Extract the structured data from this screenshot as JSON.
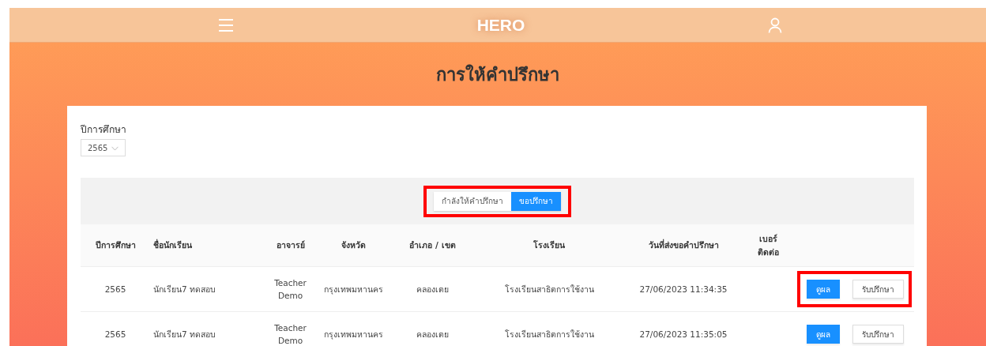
{
  "header": {
    "logo": "HERO"
  },
  "page_title": "การให้คำปรึกษา",
  "filter": {
    "label": "ปีการศึกษา",
    "value": "2565"
  },
  "toggle": {
    "highlighted": true,
    "options": [
      {
        "label": "กำลังให้คำปรึกษา",
        "selected": false
      },
      {
        "label": "ขอปรึกษา",
        "selected": true
      }
    ]
  },
  "table": {
    "columns": [
      "ปีการศึกษา",
      "ชื่อนักเรียน",
      "อาจารย์",
      "จังหวัด",
      "อำเภอ / เขต",
      "โรงเรียน",
      "วันที่ส่งขอคำปรึกษา",
      "เบอร์ ติดต่อ"
    ],
    "rows": [
      {
        "cells": [
          "2565",
          "นักเรียน7 ทดสอบ",
          "Teacher Demo",
          "กรุงเทพมหานคร",
          "คลองเตย",
          "โรงเรียนสาธิตการใช้งาน",
          "27/06/2023 11:34:35"
        ],
        "actions": [
          "ดูผล",
          "รับปรึกษา"
        ],
        "highlighted": true
      },
      {
        "cells": [
          "2565",
          "นักเรียน7 ทดสอบ",
          "Teacher Demo",
          "กรุงเทพมหานคร",
          "คลองเตย",
          "โรงเรียนสาธิตการใช้งาน",
          "27/06/2023 11:35:05"
        ],
        "actions": [
          "ดูผล",
          "รับปรึกษา"
        ],
        "highlighted": false
      }
    ]
  }
}
